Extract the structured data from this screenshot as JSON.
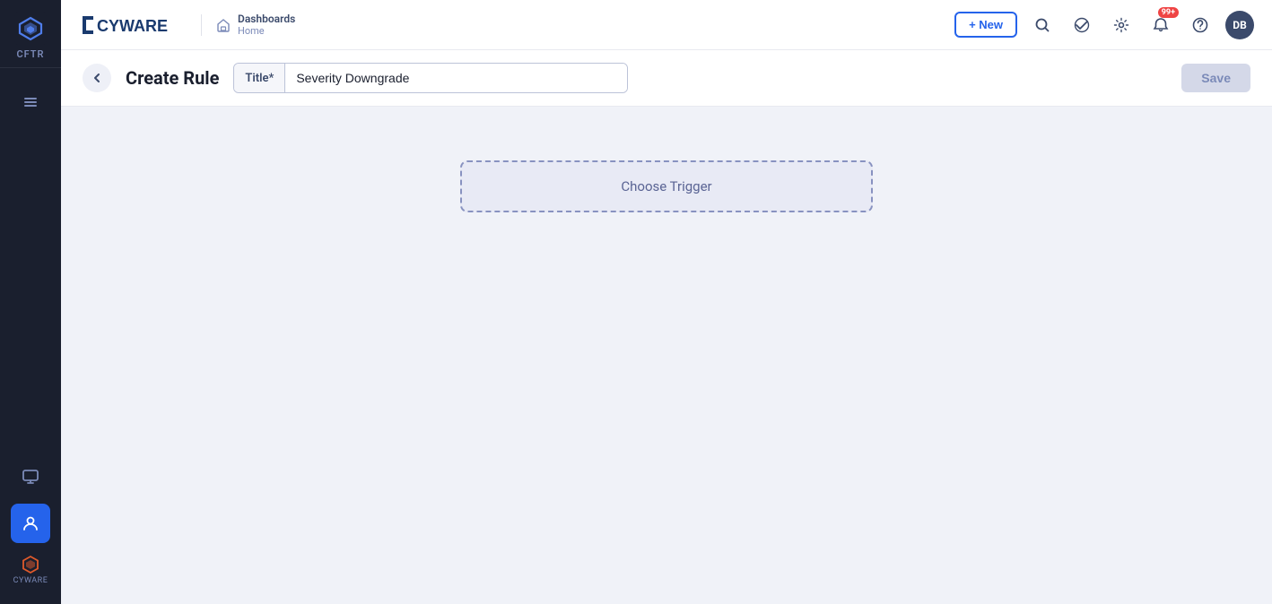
{
  "sidebar": {
    "logo_text": "CFTR",
    "items": [
      {
        "name": "menu-icon",
        "label": "Menu",
        "active": false
      },
      {
        "name": "monitor-icon",
        "label": "Monitor",
        "active": false
      },
      {
        "name": "user-icon",
        "label": "User",
        "active": true
      },
      {
        "name": "cyware-icon",
        "label": "CYWARE",
        "active": false
      }
    ]
  },
  "topbar": {
    "brand_name": "CYWARE",
    "breadcrumb_title": "Dashboards",
    "breadcrumb_sub": "Home",
    "new_button_label": "+ New",
    "notification_badge": "99+",
    "avatar_initials": "DB"
  },
  "rule_header": {
    "page_title": "Create Rule",
    "title_label": "Title*",
    "title_value": "Severity Downgrade",
    "save_label": "Save"
  },
  "canvas": {
    "choose_trigger_label": "Choose Trigger"
  }
}
